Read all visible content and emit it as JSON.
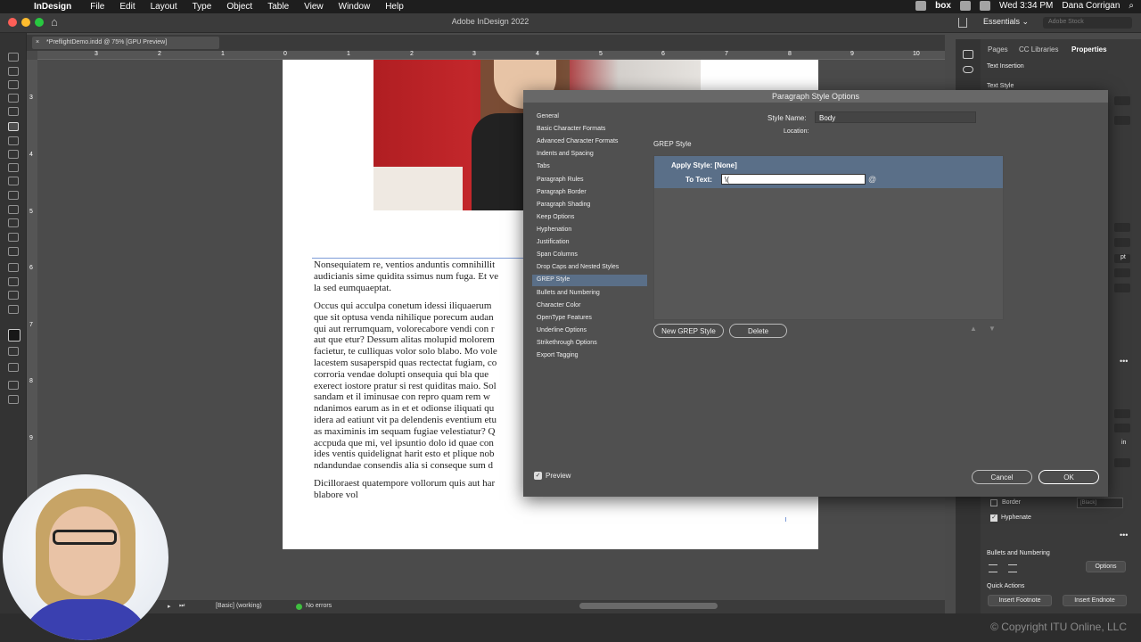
{
  "menubar": {
    "apple_icon": "",
    "app_name": "InDesign",
    "items": [
      "File",
      "Edit",
      "Layout",
      "Type",
      "Object",
      "Table",
      "View",
      "Window",
      "Help"
    ],
    "status_icons": [
      "dropbox-icon",
      "box-icon",
      "wifi-icon",
      "battery-icon"
    ],
    "box_label": "box",
    "clock": "Wed 3:34 PM",
    "user": "Dana Corrigan",
    "search_icon": "⌕"
  },
  "titlebar": {
    "title": "Adobe InDesign 2022",
    "workspace": "Essentials ⌄",
    "stock_placeholder": "Adobe Stock",
    "home_icon": "⌂"
  },
  "doc": {
    "tab_label": "*PreflightDemo.indd @ 75% [GPU Preview]",
    "tab_close": "×",
    "ruler_h": [
      "3",
      "2",
      "1",
      "0",
      "1",
      "2",
      "3",
      "4",
      "5",
      "6",
      "7",
      "8",
      "9",
      "10"
    ],
    "ruler_v": [
      "3",
      "4",
      "5",
      "6",
      "7",
      "8",
      "9"
    ],
    "paragraphs": [
      [
        "Nonsequiatem re, ventios anduntis comnihillit",
        "audicianis sime quidita ssimus num fuga. Et ve",
        "la sed eumquaeptat."
      ],
      [
        "Occus qui acculpa conetum idessi iliquaerum",
        "que sit optusa venda nihilique porecum audan",
        "qui aut rerrumquam, volorecabore vendi con r",
        "aut que etur? Dessum alitas molupid molorem",
        "facietur, te culliquas volor solo blabo. Mo vole",
        "lacestem susaperspid quas rectectat fugiam, co",
        "corroria vendae dolupti onsequia qui bla que",
        "exerect iostore pratur si rest quiditas maio. Sol",
        "sandam et il iminusae con repro quam rem w",
        "ndanimos earum as in et et odionse iliquati qu",
        "idera ad eatiunt vit pa delendenis eventium etu",
        "as maximinis im sequam fugiae velestiatur? Q",
        "accpuda que mi, vel ipsuntio dolo id quae con",
        "ides ventis quidelignat harit esto et plique nob",
        "ndandundae consendis alia si conseque sum d"
      ],
      [
        "Dicilloraest quatempore vollorum quis aut har",
        "blabore vol"
      ]
    ]
  },
  "statusbar": {
    "style": "[Basic] (working)",
    "errors": "No errors"
  },
  "panel": {
    "tabs": [
      "Pages",
      "CC Libraries",
      "Properties"
    ],
    "text_insertion": "Text Insertion",
    "text_style": "Text Style",
    "border_label": "Border",
    "black_label": "[Black]",
    "hyphenate_label": "Hyphenate",
    "bullets_label": "Bullets and Numbering",
    "options_button": "Options",
    "quick_actions": "Quick Actions",
    "insert_footnote": "Insert Footnote",
    "insert_endnote": "Insert Endnote",
    "pt_label": "pt",
    "in_label": "in"
  },
  "dialog": {
    "title": "Paragraph Style Options",
    "nav": [
      "General",
      "Basic Character Formats",
      "Advanced Character Formats",
      "Indents and Spacing",
      "Tabs",
      "Paragraph Rules",
      "Paragraph Border",
      "Paragraph Shading",
      "Keep Options",
      "Hyphenation",
      "Justification",
      "Span Columns",
      "Drop Caps and Nested Styles",
      "GREP Style",
      "Bullets and Numbering",
      "Character Color",
      "OpenType Features",
      "Underline Options",
      "Strikethrough Options",
      "Export Tagging"
    ],
    "selected_nav_index": 13,
    "style_name_label": "Style Name:",
    "style_name": "Body",
    "location_label": "Location:",
    "section_heading": "GREP Style",
    "apply_style": "Apply Style: [None]",
    "to_text_label": "To Text:",
    "to_text_value": "\\(",
    "at_icon": "@",
    "new_grep_button": "New GREP Style",
    "delete_button": "Delete",
    "preview_label": "Preview",
    "preview_checked": true,
    "cancel_button": "Cancel",
    "ok_button": "OK"
  },
  "footer": {
    "copyright": "© Copyright ITU Online, LLC"
  }
}
